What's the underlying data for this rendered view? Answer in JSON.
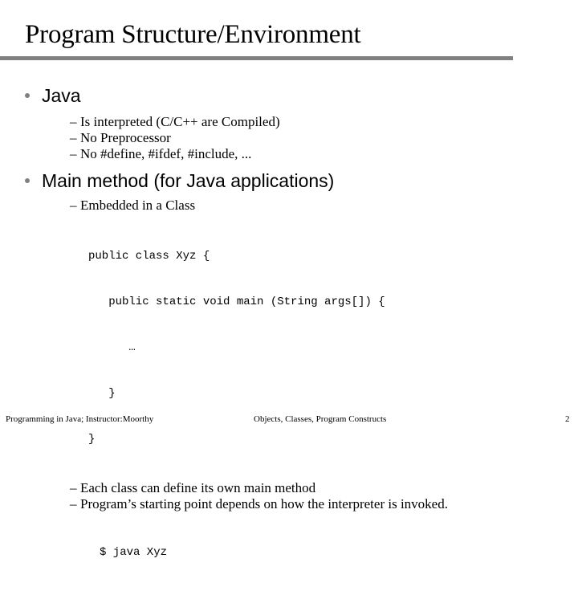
{
  "slide": {
    "title": "Program Structure/Environment",
    "rule_color": "#808080",
    "bullet_color": "#808080",
    "background_color": "#ffffff",
    "text_color": "#000000"
  },
  "sections": [
    {
      "heading": "Java",
      "dash": "–",
      "sub_bullets": [
        "Is interpreted (C/C++ are Compiled)",
        "No Preprocessor",
        "No #define, #ifdef, #include, ..."
      ]
    },
    {
      "heading": "Main method (for Java applications)",
      "dash": "–",
      "sub_bullets": [
        "Embedded in a Class",
        "Each class can define its own main method",
        "Program’s starting point depends on how the interpreter is invoked."
      ]
    }
  ],
  "code_class": {
    "lines": [
      "public class Xyz {",
      "   public static void main (String args[]) {",
      "      …",
      "   }",
      "}"
    ]
  },
  "code_shell": {
    "lines": [
      "$ java Xyz"
    ]
  },
  "footer": {
    "left": "Programming in Java; Instructor:Moorthy",
    "center": "Objects, Classes, Program Constructs",
    "page": "2"
  }
}
